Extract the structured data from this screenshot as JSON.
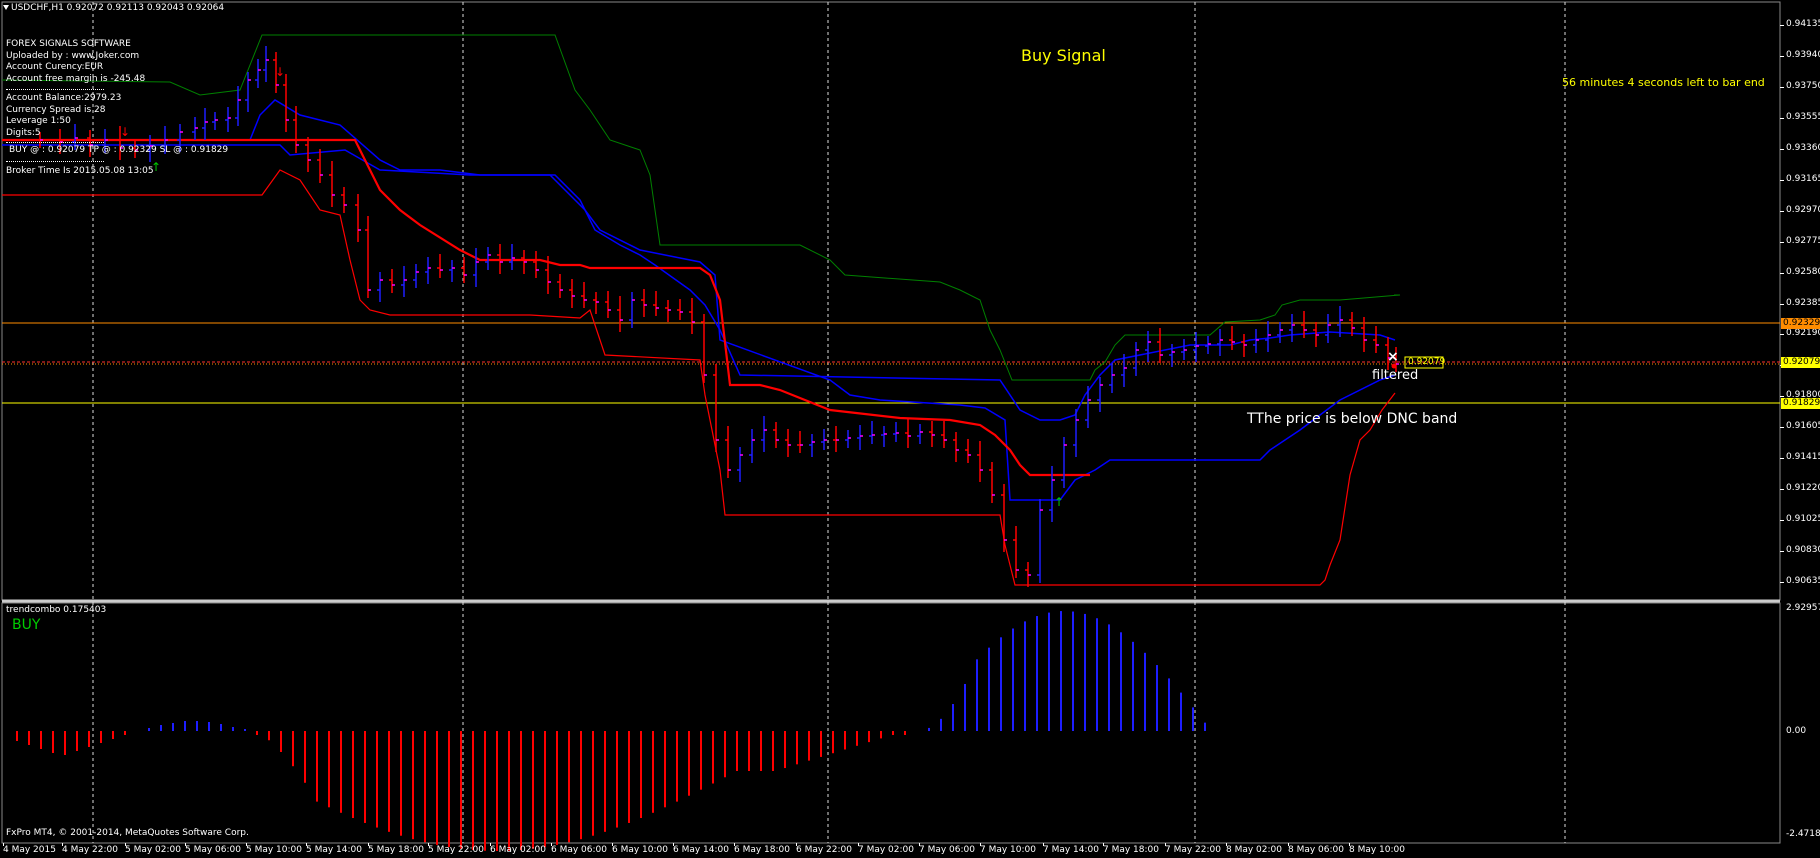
{
  "header": {
    "symbol_info": "USDCHF,H1  0.92072 0.92113 0.92043 0.92064"
  },
  "info_panel": {
    "title": "FOREX SIGNALS SOFTWARE",
    "uploaded_by": "Uploaded by : www.Joker.com",
    "currency": "Account Curency:EUR",
    "free_margin": "Account free margin is -245.48",
    "balance": "Account Balance:2979.23",
    "spread": "Currency Spread is 28",
    "leverage": "Leverage 1:50",
    "digits": "Digits:5",
    "order": "BUY @ : 0.92079  TP @ : 0.92329  SL @ : 0.91829",
    "broker_time": "Broker Time Is 2015.05.08 13:05"
  },
  "annotations": {
    "buy_signal": "Buy Signal",
    "bar_timer": "56 minutes 4 seconds left to bar end",
    "filtered": "filtered",
    "dnc_note": "TThe price is below DNC band"
  },
  "price_axis": [
    "0.94135",
    "0.93940",
    "0.93750",
    "0.93555",
    "0.93360",
    "0.93165",
    "0.92970",
    "0.92775",
    "0.92580",
    "0.92385",
    "0.92190",
    "0.91990",
    "0.91800",
    "0.91605",
    "0.91415",
    "0.91220",
    "0.91025",
    "0.90830",
    "0.90635"
  ],
  "price_tags": {
    "tp": "0.92329",
    "entry": "0.92079",
    "sl": "0.91829",
    "current": "0.92079"
  },
  "indicator": {
    "name": "trendcombo 0.175403",
    "signal": "BUY",
    "axis_top": "2.92957",
    "axis_zero": "0.00",
    "axis_bottom": "-2.471864"
  },
  "time_axis": [
    "4 May 2015",
    "4 May 22:00",
    "5 May 02:00",
    "5 May 06:00",
    "5 May 10:00",
    "5 May 14:00",
    "5 May 18:00",
    "5 May 22:00",
    "6 May 02:00",
    "6 May 06:00",
    "6 May 10:00",
    "6 May 14:00",
    "6 May 18:00",
    "6 May 22:00",
    "7 May 02:00",
    "7 May 06:00",
    "7 May 10:00",
    "7 May 14:00",
    "7 May 18:00",
    "7 May 22:00",
    "8 May 02:00",
    "8 May 06:00",
    "8 May 10:00"
  ],
  "copyright": "FxPro MT4, © 2001-2014, MetaQuotes Software Corp.",
  "colors": {
    "background": "#000000",
    "up_bar": "#0000ff",
    "down_bar": "#ff0000",
    "mid_band": "#ff0000",
    "outer_band": "#0000ff",
    "green_band": "#008000",
    "tp_line": "#ff8c00",
    "sl_line": "#ffff00",
    "text_yellow": "#ffff00"
  }
}
